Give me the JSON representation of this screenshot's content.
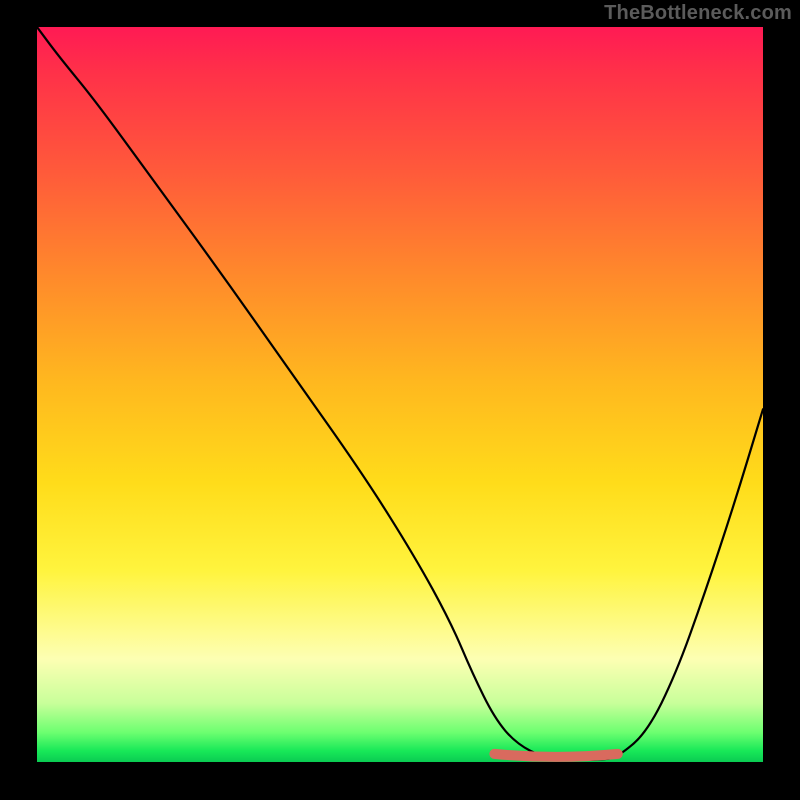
{
  "watermark": "TheBottleneck.com",
  "colors": {
    "curve": "#000000",
    "trough_highlight": "#d96a5e",
    "frame_bg": "#000000",
    "watermark_text": "#5b5b5b"
  },
  "chart_data": {
    "type": "line",
    "title": "",
    "xlabel": "",
    "ylabel": "",
    "xlim": [
      0,
      100
    ],
    "ylim": [
      0,
      100
    ],
    "series": [
      {
        "name": "bottleneck-curve",
        "x": [
          0,
          3,
          8,
          15,
          25,
          35,
          45,
          52,
          57,
          60,
          63,
          66,
          70,
          74,
          78,
          80,
          84,
          88,
          92,
          96,
          100
        ],
        "y": [
          100,
          96,
          90,
          80.5,
          67,
          53,
          39,
          28,
          19,
          12,
          6,
          2.5,
          0.5,
          0.3,
          0.3,
          0.7,
          4,
          12,
          23,
          35,
          48
        ]
      }
    ],
    "trough_highlight": {
      "x_start": 63,
      "x_end": 80,
      "y_level": 0.7
    },
    "gradient_stops": [
      {
        "pos": 0,
        "color": "#ff1a54"
      },
      {
        "pos": 0.2,
        "color": "#ff5b3a"
      },
      {
        "pos": 0.48,
        "color": "#ffb71f"
      },
      {
        "pos": 0.74,
        "color": "#fff43e"
      },
      {
        "pos": 0.92,
        "color": "#c8ff9a"
      },
      {
        "pos": 1.0,
        "color": "#0acb52"
      }
    ]
  }
}
